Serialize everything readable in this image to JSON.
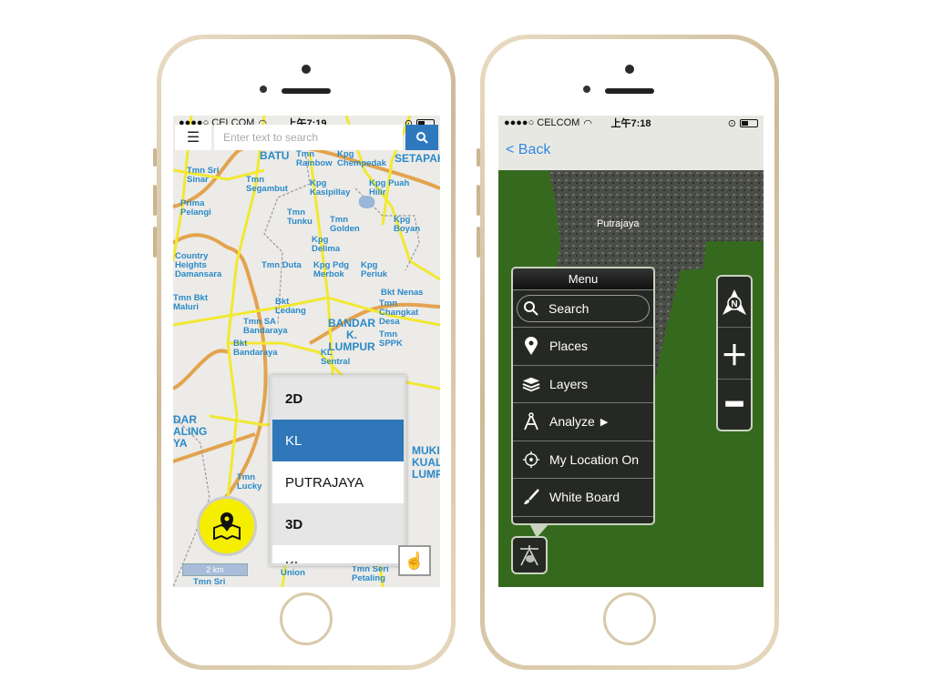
{
  "left_phone": {
    "status": {
      "carrier": "●●●●○ CELCOM",
      "time": "上午7:19"
    },
    "search": {
      "menu_icon": "hamburger-icon",
      "placeholder": "Enter text to search",
      "button_icon": "search-icon"
    },
    "map_labels": [
      "BATU",
      "Tmn\nRainbow",
      "Kpg\nChempedak",
      "SETAPAK",
      "Tmn Sri\nSinar",
      "Tmn\nSegambut",
      "Kpg\nKasipillay",
      "Kpg Puah\nHilir",
      "Prima\nPelangi",
      "Tmn\nTunku",
      "Tmn\nGolden",
      "Kpg\nBoyan",
      "Kpg\nDelima",
      "Country\nHeights\nDamansara",
      "Tmn Duta",
      "Kpg Pdg\nMerbok",
      "Kpg\nPeriuk",
      "Bkt Nenas",
      "Tmn Bkt\nMaluri",
      "Bkt\nLedang",
      "Tmn\nChangkat\nDesa",
      "Tmn SA\nBandaraya",
      "BANDAR\nK.\nLUMPUR",
      "Tmn\nSPPK",
      "Bkt\nBandaraya",
      "KL\nSentral",
      "DAR\nALING\nYA",
      "MUKI\nKUAL\nLUMP",
      "Tmn\nLucky",
      "Union",
      "Tmn Seri\nPetaling",
      "Tmn Sri"
    ],
    "dropdown": {
      "items": [
        {
          "label": "2D",
          "type": "header"
        },
        {
          "label": "KL",
          "type": "selected"
        },
        {
          "label": "PUTRAJAYA",
          "type": "option"
        },
        {
          "label": "3D",
          "type": "header"
        },
        {
          "label": "KL",
          "type": "option"
        }
      ]
    },
    "scale_label": "2 km",
    "fab_icon": "map-pin-icon",
    "touch_icon": "hand-pointer-icon",
    "colors": {
      "accent": "#2f77b8",
      "fab": "#f5ee00",
      "road_major": "#f2e832",
      "road_highway": "#e3a34e",
      "label": "#2a8ac8"
    }
  },
  "right_phone": {
    "status": {
      "carrier": "●●●●○ CELCOM",
      "time": "上午7:18"
    },
    "back_label": "< Back",
    "map_label": "Putrajaya",
    "menu": {
      "title": "Menu",
      "search_label": "Search",
      "items": [
        {
          "label": "Places",
          "icon": "map-pin-icon"
        },
        {
          "label": "Layers",
          "icon": "layers-icon"
        },
        {
          "label": "Analyze",
          "icon": "compass-tool-icon",
          "submenu": true
        },
        {
          "label": "My Location On",
          "icon": "crosshair-icon"
        },
        {
          "label": "White Board",
          "icon": "brush-icon"
        }
      ]
    },
    "compass_label": "N",
    "colors": {
      "map_green": "#356a1e",
      "panel": "#262923",
      "back": "#2f8ae5"
    }
  }
}
